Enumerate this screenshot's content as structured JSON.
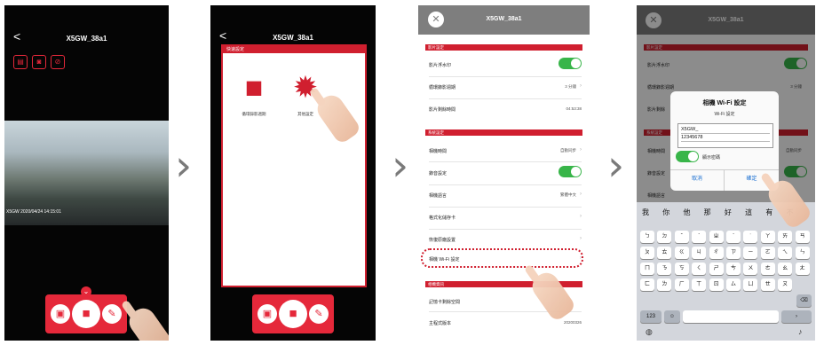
{
  "arrows": [
    "›",
    "›",
    "›"
  ],
  "phone1": {
    "title": "X5GW_38a1",
    "back_icon": "chevron-left-icon",
    "mode_icons": [
      "sd-card-icon",
      "camera-icon",
      "mic-off-icon"
    ],
    "video_timestamp": "X5GW 2020/04/24 14:15:01",
    "dock_icons": [
      "gallery-icon",
      "video-camera-icon",
      "wrench-icon"
    ]
  },
  "phone2": {
    "title": "X5GW_38a1",
    "panel_header": "快速設定",
    "tiles": [
      {
        "label": "循環錄影週期",
        "icon": "video-camera-icon"
      },
      {
        "label": "其他設定",
        "icon": "gear-icon"
      }
    ]
  },
  "phone3": {
    "title": "X5GW_38a1",
    "sections": [
      {
        "header": "影片設定",
        "rows": [
          {
            "label": "影片浮水印",
            "value": "",
            "toggle": true
          },
          {
            "label": "循環錄影週期",
            "value": "3 分鐘",
            "toggle": false
          },
          {
            "label": "影片剩餘時間",
            "value": "04:53:38",
            "toggle": false
          }
        ]
      },
      {
        "header": "系統設定",
        "rows": [
          {
            "label": "相機時間",
            "value": "自動同步",
            "toggle": false
          },
          {
            "label": "錄音設定",
            "value": "",
            "toggle": true
          },
          {
            "label": "相機語言",
            "value": "繁體中文",
            "toggle": false
          },
          {
            "label": "格式化儲存卡",
            "value": "",
            "toggle": false
          },
          {
            "label": "恢復原廠設置",
            "value": "",
            "toggle": false
          },
          {
            "label": "相機 Wi-Fi 設定",
            "value": "",
            "toggle": false
          }
        ]
      },
      {
        "header": "相機資訊",
        "rows": [
          {
            "label": "記憶卡剩餘空間",
            "value": "",
            "toggle": false
          },
          {
            "label": "主程式版本",
            "value": "20200326",
            "toggle": false
          }
        ]
      }
    ]
  },
  "phone4": {
    "title": "X5GW_38a1",
    "bg_rows": [
      "影片浮水印",
      "循環錄影週期",
      "影片剩餘",
      "相機時間",
      "錄音設定",
      "相機語言"
    ],
    "bg_values": [
      "3 分鐘",
      "自動同步"
    ],
    "dialog": {
      "title": "相機 Wi-Fi 設定",
      "subtitle": "Wi-Fi 設定",
      "ssid": "X5GW_",
      "password": "12345678",
      "toggle_label": "顯示密碼",
      "cancel": "取消",
      "confirm": "確定"
    },
    "keyboard": {
      "suggestions": "我 你 他 那 好 這 有 不",
      "row1": [
        "ㄅ",
        "ㄉ",
        "ˇ",
        "ˋ",
        "ㄓ",
        "ˊ",
        "˙",
        "ㄚ",
        "ㄞ",
        "ㄢ"
      ],
      "row2": [
        "ㄆ",
        "ㄊ",
        "ㄍ",
        "ㄐ",
        "ㄔ",
        "ㄗ",
        "ㄧ",
        "ㄛ",
        "ㄟ",
        "ㄣ"
      ],
      "row3": [
        "ㄇ",
        "ㄋ",
        "ㄎ",
        "ㄑ",
        "ㄕ",
        "ㄘ",
        "ㄨ",
        "ㄜ",
        "ㄠ",
        "ㄤ"
      ],
      "row4": [
        "ㄈ",
        "ㄌ",
        "ㄏ",
        "ㄒ",
        "ㄖ",
        "ㄙ",
        "ㄩ",
        "ㄝ",
        "ㄡ",
        "ㄥ"
      ],
      "numkey": "123",
      "emoji_icon": "emoji-icon",
      "globe_icon": "globe-icon",
      "mic_icon": "mic-icon",
      "delete_icon": "backspace-icon",
      "next_icon": "return-icon"
    }
  },
  "colors": {
    "accent": "#d01f2f",
    "toggle_on": "#38b549",
    "link": "#1a6fd1"
  }
}
